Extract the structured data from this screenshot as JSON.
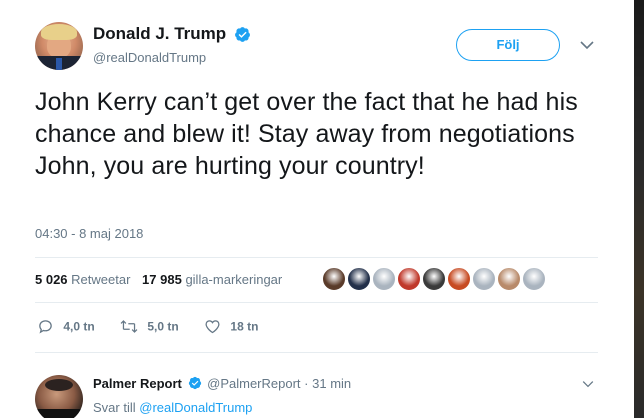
{
  "tweet": {
    "display_name": "Donald J. Trump",
    "handle": "@realDonaldTrump",
    "follow_label": "Följ",
    "text": "John Kerry can’t get over the fact that he had his chance and blew it! Stay away from negotiations John, you are hurting your country!",
    "timestamp": "04:30 - 8 maj 2018",
    "stats": {
      "retweets_count": "5 026",
      "retweets_label": "Retweetar",
      "likes_count": "17 985",
      "likes_label": "gilla-markeringar"
    },
    "liker_avatars": [
      {
        "color": "#5a3b2a"
      },
      {
        "color": "#23304a"
      },
      {
        "color": "#aab4bf"
      },
      {
        "color": "#c0392b"
      },
      {
        "color": "#3a3a3a"
      },
      {
        "color": "#c74b23"
      },
      {
        "color": "#aab4bf"
      },
      {
        "color": "#b88a6a"
      },
      {
        "color": "#aab4bf"
      }
    ],
    "actions": {
      "reply_count": "4,0 tn",
      "retweet_count": "5,0 tn",
      "like_count": "18 tn"
    }
  },
  "reply": {
    "display_name": "Palmer Report",
    "handle": "@PalmerReport",
    "separator": "·",
    "time_ago": "31 min",
    "reply_prefix": "Svar till",
    "reply_to_handle": "@realDonaldTrump"
  },
  "colors": {
    "accent": "#1da1f2",
    "text_primary": "#14171a",
    "text_secondary": "#657786",
    "divider": "#e6ecf0"
  },
  "icons": {
    "verified": "verified-badge-icon",
    "caret": "chevron-down-icon",
    "reply": "reply-icon",
    "retweet": "retweet-icon",
    "like": "heart-icon"
  }
}
